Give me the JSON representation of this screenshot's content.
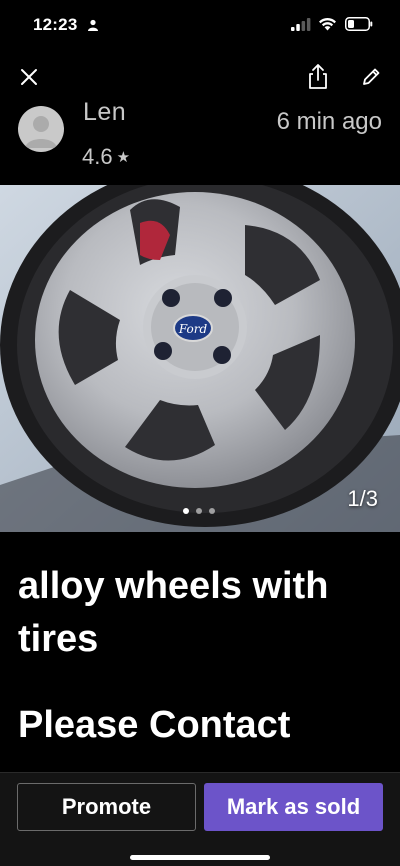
{
  "status_bar": {
    "time": "12:23",
    "icons": [
      "person-icon",
      "signal-icon",
      "wifi-icon",
      "battery-icon"
    ]
  },
  "top_actions": {
    "icons": [
      "close-icon",
      "share-icon",
      "edit-icon"
    ]
  },
  "seller": {
    "name": "Len",
    "rating": "4.6",
    "rating_icon": "★",
    "posted": "6 min  ago"
  },
  "photo": {
    "counter": "1/3",
    "current_index": 1,
    "total": 3,
    "hub_logo_text": "Ford"
  },
  "listing": {
    "title": "alloy wheels with tires",
    "description": "Please Contact"
  },
  "actions": {
    "promote_label": "Promote",
    "mark_sold_label": "Mark as sold"
  },
  "colors": {
    "background": "#000000",
    "bottom_bar": "#141414",
    "primary_button": "#6c54c9",
    "text_muted": "#c8c8c8"
  }
}
